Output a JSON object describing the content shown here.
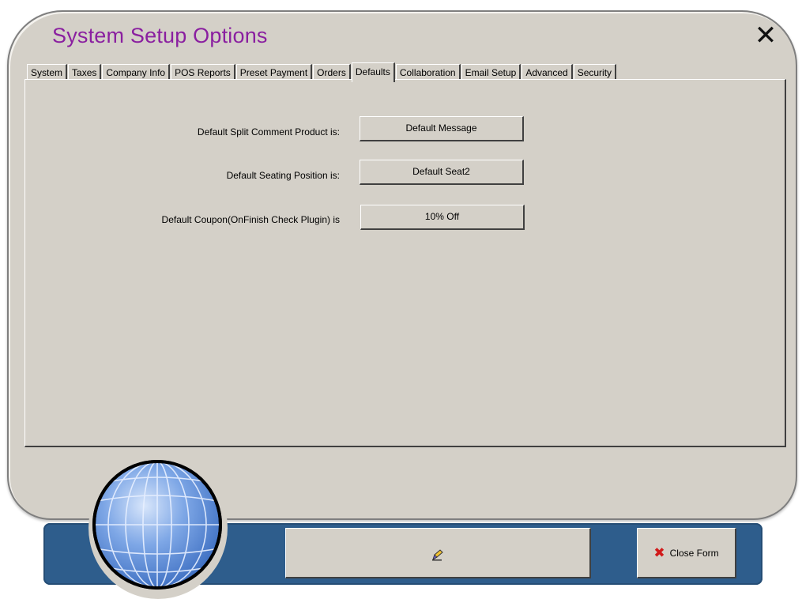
{
  "window": {
    "title": "System Setup Options",
    "close_symbol": "✕"
  },
  "tabs": [
    {
      "label": "System",
      "active": false
    },
    {
      "label": "Taxes",
      "active": false
    },
    {
      "label": "Company Info",
      "active": false
    },
    {
      "label": "POS Reports",
      "active": false
    },
    {
      "label": "Preset Payment",
      "active": false
    },
    {
      "label": "Orders",
      "active": false
    },
    {
      "label": "Defaults",
      "active": true
    },
    {
      "label": "Collaboration",
      "active": false
    },
    {
      "label": "Email Setup",
      "active": false
    },
    {
      "label": "Advanced",
      "active": false
    },
    {
      "label": "Security",
      "active": false
    }
  ],
  "defaults": {
    "split_comment": {
      "label": "Default Split Comment Product is:",
      "value": "Default Message"
    },
    "seating_position": {
      "label": "Default Seating Position is:",
      "value": "Default Seat2"
    },
    "coupon": {
      "label": "Default Coupon(OnFinish Check Plugin) is",
      "value": "10% Off"
    }
  },
  "footer": {
    "close_form_label": "Close Form",
    "close_form_icon": "red-x-icon",
    "action_icon": "edit-pencil-icon",
    "logo_icon": "globe-icon"
  },
  "colors": {
    "title": "#8a1fa0",
    "window_bg": "#d4d0c8",
    "bottom_bar": "#2e5d8c",
    "globe": "#5b8fd6",
    "close_x_red": "#d11a1a"
  }
}
